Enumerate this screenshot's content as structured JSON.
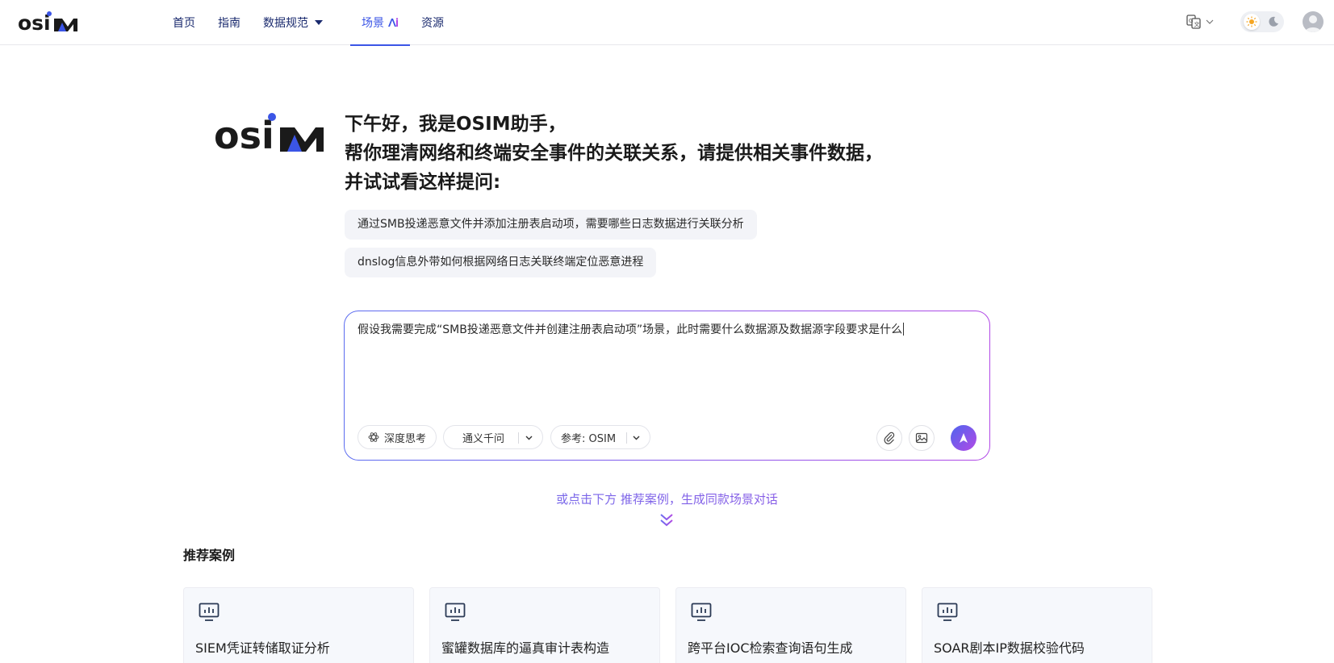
{
  "brand": {
    "logo_text": "OSIM",
    "accent": "#3b55e6",
    "gradient_from": "#5b6cf0",
    "gradient_to": "#b148e6"
  },
  "nav": {
    "items": [
      {
        "label": "首页"
      },
      {
        "label": "指南"
      },
      {
        "label": "数据规范"
      },
      {
        "label": "场景"
      },
      {
        "label": "资源"
      }
    ],
    "active": "场景"
  },
  "header_actions": {
    "language_icon": "translate-icon",
    "theme_toggle": {
      "light_icon": "sun-icon",
      "dark_icon": "moon-icon"
    },
    "avatar": "user-avatar"
  },
  "hero": {
    "greeting_lines": [
      "下午好，我是OSIM助手，",
      "帮你理清网络和终端安全事件的关联关系，请提供相关事件数据，",
      "并试试看这样提问:"
    ],
    "suggestions": [
      "通过SMB投递恶意文件并添加注册表启动项，需要哪些日志数据进行关联分析",
      "dnslog信息外带如何根据网络日志关联终端定位恶意进程"
    ]
  },
  "chat": {
    "input_value": "假设我需要完成“SMB投递恶意文件并创建注册表启动项”场景，此时需要什么数据源及数据源字段要求是什么",
    "deep_think_label": "深度思考",
    "model_label": "通义千问",
    "reference_label": "参考: OSIM"
  },
  "hint": "或点击下方 推荐案例，生成同款场景对话",
  "recommended": {
    "title": "推荐案例",
    "cards": [
      {
        "title": "SIEM凭证转储取证分析"
      },
      {
        "title": "蜜罐数据库的逼真审计表构造"
      },
      {
        "title": "跨平台IOC检索查询语句生成"
      },
      {
        "title": "SOAR剧本IP数据校验代码"
      }
    ]
  }
}
